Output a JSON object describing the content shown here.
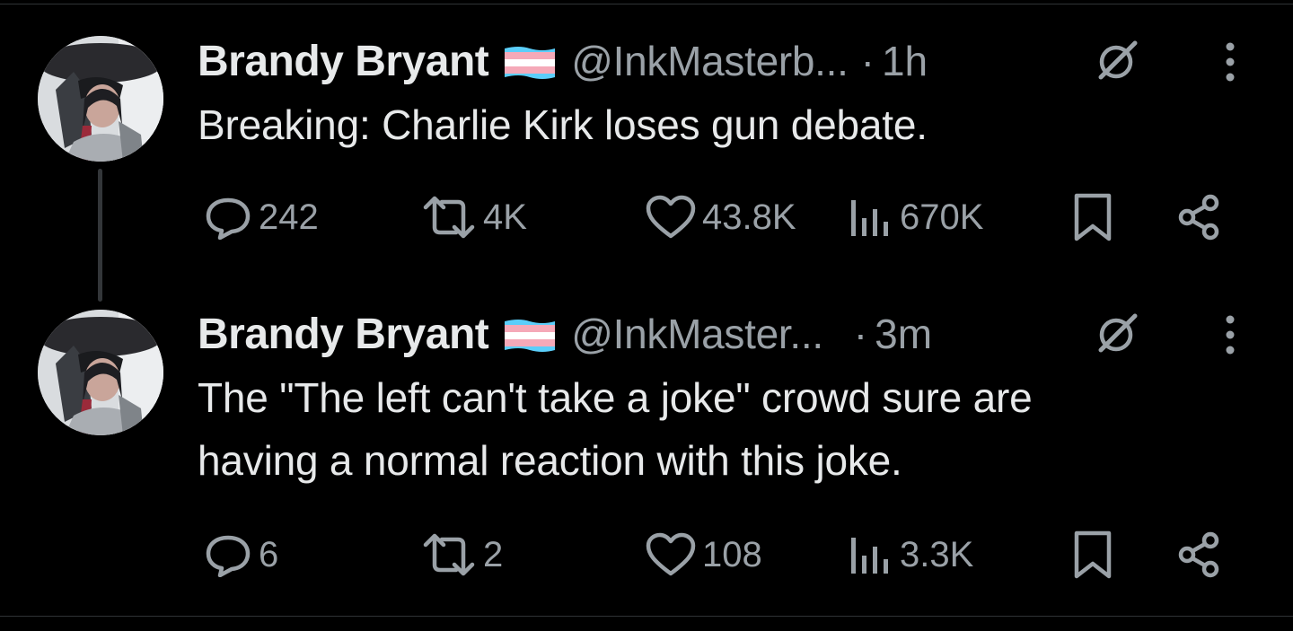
{
  "tweets": [
    {
      "name": "Brandy Bryant",
      "handle": "@InkMasterb...",
      "separator": "·",
      "time": "1h",
      "text_lines": [
        "Breaking: Charlie Kirk loses gun debate."
      ],
      "replies": "242",
      "reposts": "4K",
      "likes": "43.8K",
      "views": "670K"
    },
    {
      "name": "Brandy Bryant",
      "handle": "@InkMaster...",
      "separator": "·",
      "time": "3m",
      "text_lines": [
        "The \"The left can't take a joke\" crowd sure are",
        "having a normal reaction with this joke."
      ],
      "replies": "6",
      "reposts": "2",
      "likes": "108",
      "views": "3.3K"
    }
  ],
  "icons": {
    "flag": "transgender-flag-emoji",
    "grok": "grok-icon",
    "more": "more-vertical-icon",
    "reply": "reply-bubble-icon",
    "repost": "repost-icon",
    "like": "heart-icon",
    "views": "views-bar-icon",
    "bookmark": "bookmark-icon",
    "share": "share-icon"
  },
  "colors": {
    "background": "#000000",
    "text": "#e7e9ea",
    "secondary": "#9aa1a7",
    "flag_blue": "#5bcefa",
    "flag_pink": "#f5a9b8"
  }
}
